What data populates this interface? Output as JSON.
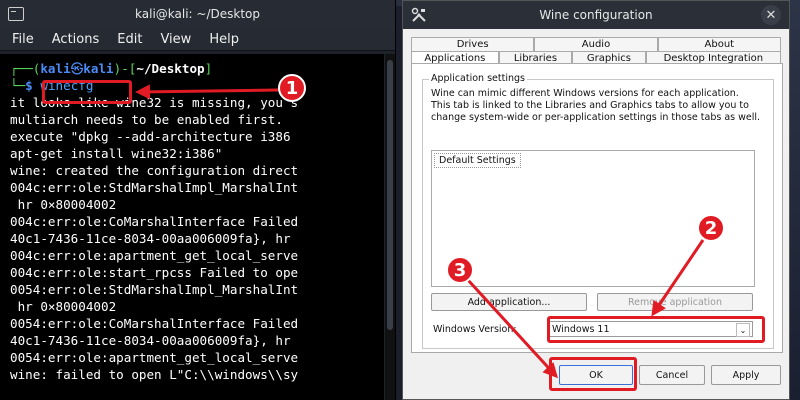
{
  "terminal": {
    "title": "kali@kali: ~/Desktop",
    "menu": [
      "File",
      "Actions",
      "Edit",
      "View",
      "Help"
    ],
    "prompt_open": "┌──(",
    "prompt_user": "kali",
    "prompt_at": "㉿",
    "prompt_host": "kali",
    "prompt_close": ")-[",
    "prompt_path": "~/Desktop",
    "prompt_end": "]",
    "prompt_line2": "└─",
    "prompt_dollar": "$",
    "command": "winecfg",
    "output": [
      "it looks like wine32 is missing, you s",
      "multiarch needs to be enabled first.",
      "execute \"dpkg --add-architecture i386",
      "apt-get install wine32:i386\"",
      "wine: created the configuration direct",
      "004c:err:ole:StdMarshalImpl_MarshalInt",
      " hr 0×80004002",
      "004c:err:ole:CoMarshalInterface Failed",
      "40c1-7436-11ce-8034-00aa006009fa}, hr",
      "004c:err:ole:apartment_get_local_serve",
      "004c:err:ole:start_rpcss Failed to ope",
      "0054:err:ole:StdMarshalImpl_MarshalInt",
      " hr 0×80004002",
      "0054:err:ole:CoMarshalInterface Failed",
      "40c1-7436-11ce-8034-00aa006009fa}, hr",
      "0054:err:ole:apartment_get_local_serve",
      "wine: failed to open L\"C:\\\\windows\\\\sy"
    ]
  },
  "wine": {
    "title": "Wine configuration",
    "close_glyph": "✕",
    "tabs_row1": [
      "Drives",
      "Audio",
      "About"
    ],
    "tabs_row2": [
      "Applications",
      "Libraries",
      "Graphics",
      "Desktop Integration"
    ],
    "group_title": "Application settings",
    "description": "Wine can mimic different Windows versions for each application. This tab is linked to the Libraries and Graphics tabs to allow you to change system-wide or per-application settings in those tabs as well.",
    "list_items": [
      "Default Settings"
    ],
    "add_button": "Add application...",
    "remove_button": "Remove application",
    "version_label": "Windows Version:",
    "version_value": "Windows 11",
    "ok": "OK",
    "cancel": "Cancel",
    "apply": "Apply"
  },
  "annotations": {
    "badges": [
      "1",
      "2",
      "3"
    ],
    "color": "#e01b24"
  }
}
